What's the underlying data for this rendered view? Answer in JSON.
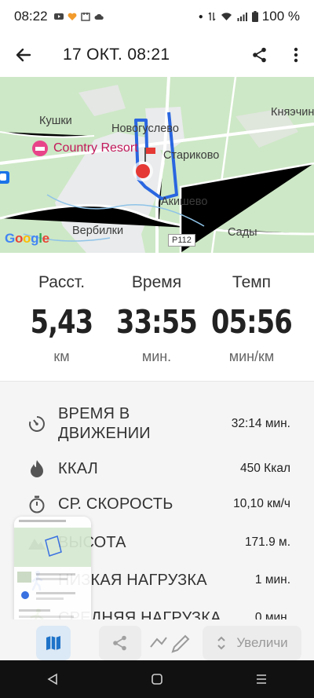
{
  "status_bar": {
    "time": "08:22",
    "battery": "100 %"
  },
  "app_bar": {
    "title": "17 ОКТ. 08:21"
  },
  "map": {
    "labels": {
      "kushki": "Кушки",
      "novogulevo": "Новогуслево",
      "knyazhchino": "Княэчин",
      "country_resort": "Country Resort",
      "starikovo": "Стариково",
      "akishevo": "Акишево",
      "verbilki": "Вербилки",
      "sady": "Сады",
      "road": "Р112",
      "google": "Google"
    },
    "colors": {
      "route": "#2a66e0",
      "land": "#cde8c6",
      "urban": "#e9ebec",
      "marker": "#e53935"
    }
  },
  "stats": {
    "distance": {
      "label": "Расст.",
      "value": "5,43",
      "unit": "км"
    },
    "time": {
      "label": "Время",
      "value": "33:55",
      "unit": "мин."
    },
    "pace": {
      "label": "Темп",
      "value": "05:56",
      "unit": "мин/км"
    }
  },
  "details": [
    {
      "icon": "moving-time-icon",
      "name": "ВРЕМЯ В ДВИЖЕНИИ",
      "value": "32:14 мин."
    },
    {
      "icon": "flame-icon",
      "name": "ККАЛ",
      "value": "450 Ккал"
    },
    {
      "icon": "stopwatch-icon",
      "name": "СР. СКОРОСТЬ",
      "value": "10,10 км/ч"
    },
    {
      "icon": "mountain-icon",
      "name": "ВЫСОТА",
      "value": "171.9 м."
    },
    {
      "icon": "walker-icon",
      "name": "НИЗКАЯ НАГРУЗКА",
      "value": "1 мин."
    },
    {
      "icon": "runner-icon",
      "name": "СРЕДНЯЯ НАГРУЗКА",
      "value": "0 мин."
    }
  ],
  "bottom_bar": {
    "zoom_label": "Увеличи"
  }
}
